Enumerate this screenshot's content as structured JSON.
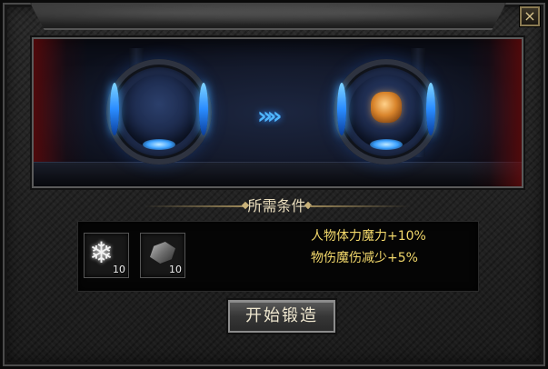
{
  "window": {
    "close_label": "×"
  },
  "scene": {
    "arrow_label": "»»"
  },
  "requirements": {
    "title": "所需条件",
    "materials": [
      {
        "icon": "snowflake-icon",
        "quantity": "10"
      },
      {
        "icon": "ore-icon",
        "quantity": "10"
      }
    ],
    "attributes": [
      "人物体力魔力+10%",
      "物伤魔伤减少+5%"
    ]
  },
  "actions": {
    "forge_label": "开始锻造"
  }
}
